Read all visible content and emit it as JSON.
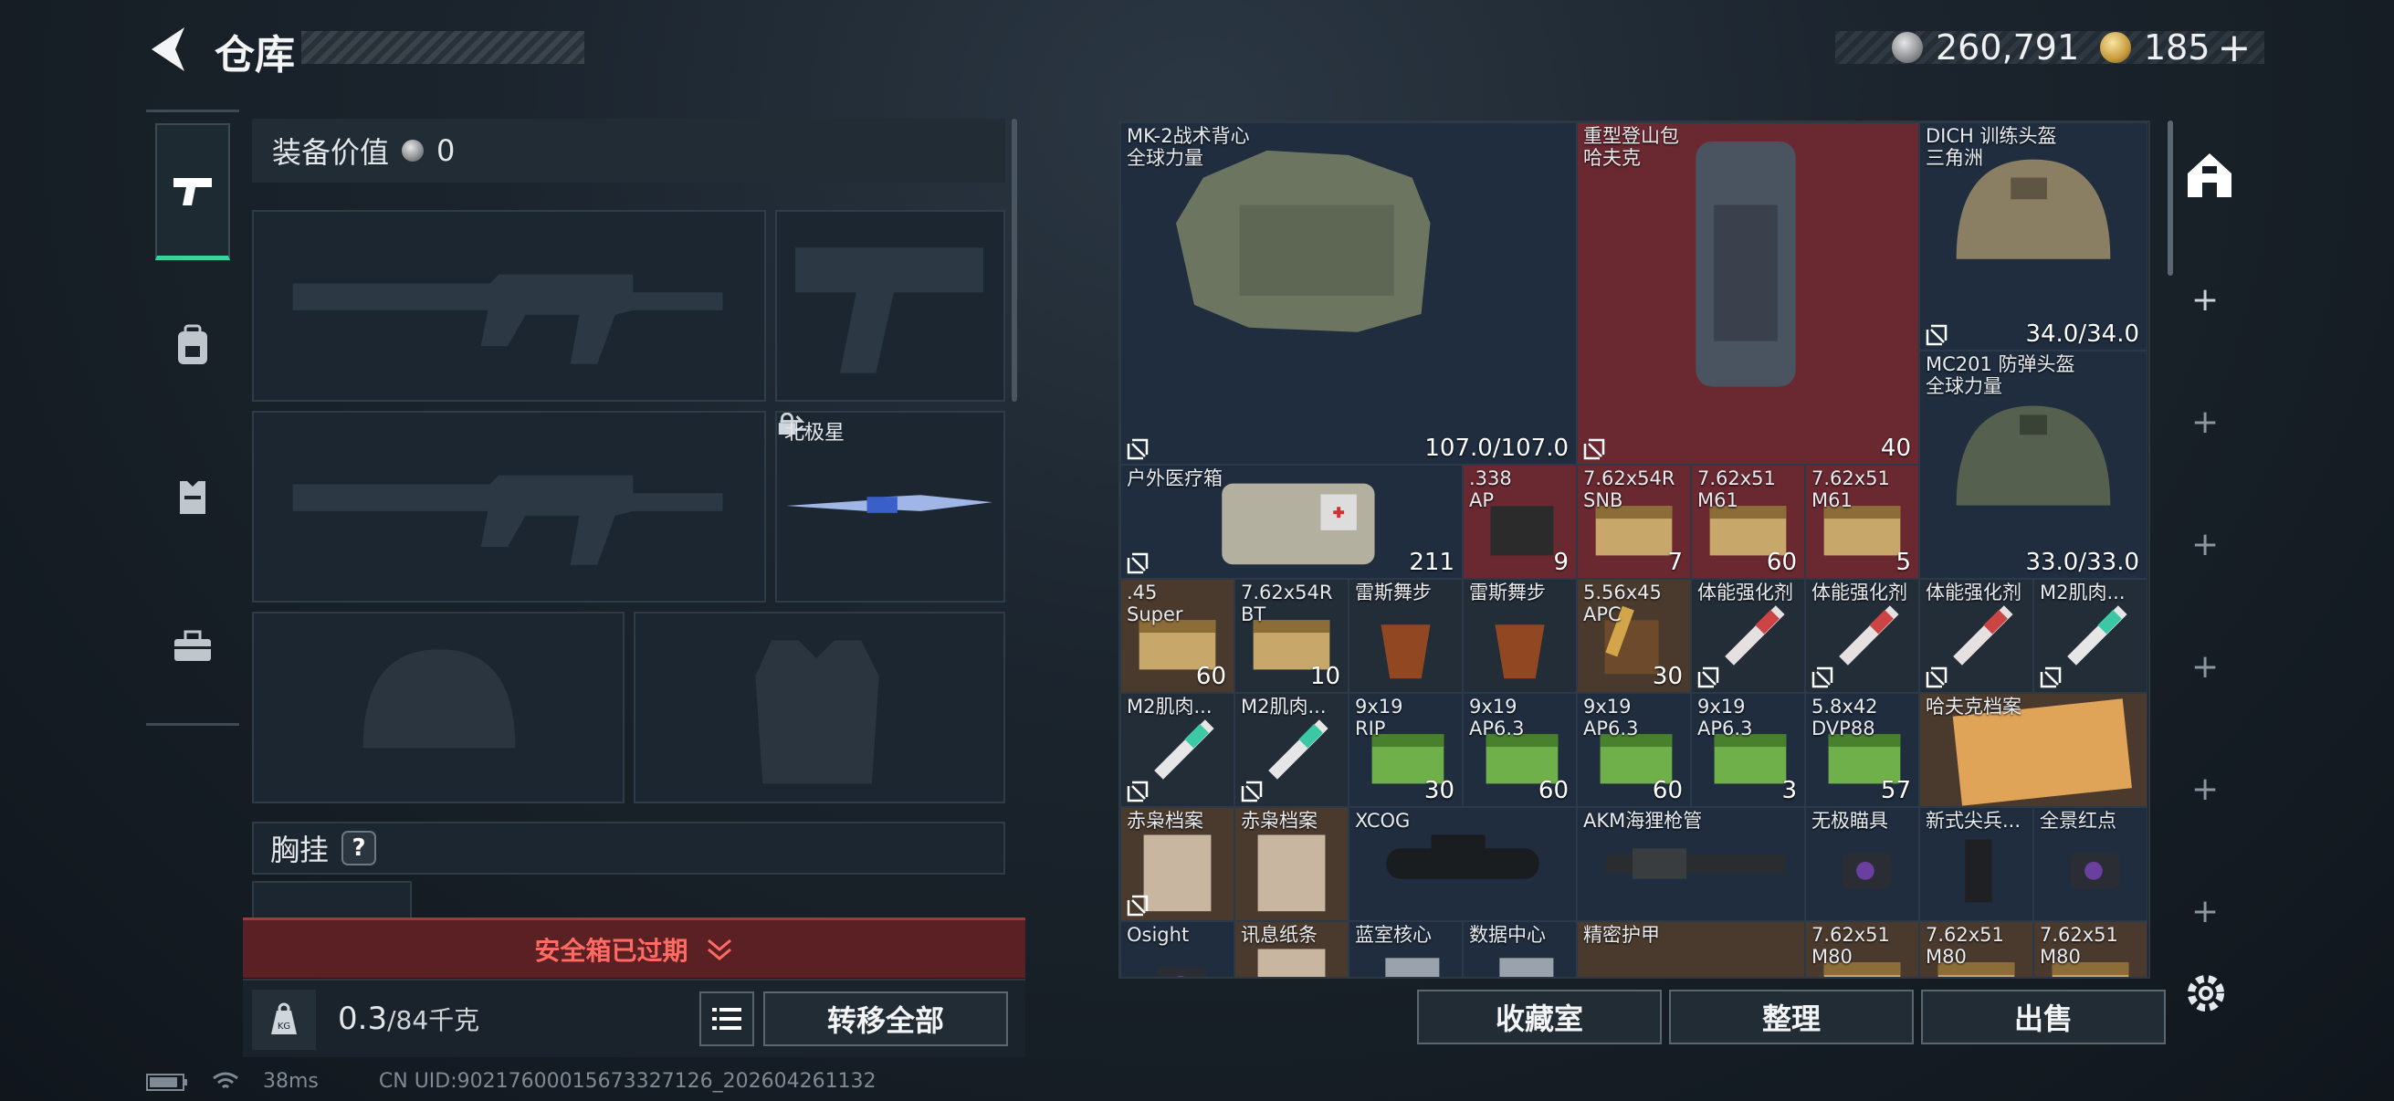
{
  "header": {
    "title": "仓库",
    "silver": "260,791",
    "gold": "185",
    "gold_plus": "+"
  },
  "loadout": {
    "value_label": "装备价值",
    "value": "0",
    "melee_name": "北极星",
    "chest_label": "胸挂",
    "chest_help": "?"
  },
  "safe_box": {
    "label": "安全箱已过期"
  },
  "bottom_left": {
    "weight_value": "0.3",
    "weight_unit": "/84千克",
    "transfer_all": "转移全部"
  },
  "inventory": [
    {
      "name": "MK-2战术背心\n全球力量",
      "count": "107.0/107.0",
      "locked": true
    },
    {
      "name": "重型登山包\n哈夫克",
      "count": "40",
      "locked": true
    },
    {
      "name": "DICH 训练头盔\n三角洲",
      "count": "34.0/34.0",
      "locked": true
    },
    {
      "name": "MC201 防弹头盔\n全球力量",
      "count": "33.0/33.0",
      "locked": false
    },
    {
      "name": "户外医疗箱",
      "count": "211",
      "locked": true
    },
    {
      "name": ".338\nAP",
      "count": "9",
      "locked": false
    },
    {
      "name": "7.62x54R\nSNB",
      "count": "7",
      "locked": false
    },
    {
      "name": "7.62x51\nM61",
      "count": "60",
      "locked": false
    },
    {
      "name": "7.62x51\nM61",
      "count": "5",
      "locked": false
    },
    {
      "name": ".45\nSuper",
      "count": "60",
      "locked": false
    },
    {
      "name": "7.62x54R\nBT",
      "count": "10",
      "locked": false
    },
    {
      "name": "雷斯舞步",
      "count": "",
      "locked": false
    },
    {
      "name": "雷斯舞步",
      "count": "",
      "locked": false
    },
    {
      "name": "5.56x45\nAPC",
      "count": "30",
      "locked": false
    },
    {
      "name": "体能强化剂",
      "count": "",
      "locked": true
    },
    {
      "name": "体能强化剂",
      "count": "",
      "locked": true
    },
    {
      "name": "体能强化剂",
      "count": "",
      "locked": true
    },
    {
      "name": "M2肌肉...",
      "count": "",
      "locked": true
    },
    {
      "name": "M2肌肉...",
      "count": "",
      "locked": true
    },
    {
      "name": "M2肌肉...",
      "count": "",
      "locked": true
    },
    {
      "name": "9x19\nRIP",
      "count": "30",
      "locked": false
    },
    {
      "name": "9x19\nAP6.3",
      "count": "60",
      "locked": false
    },
    {
      "name": "9x19\nAP6.3",
      "count": "60",
      "locked": false
    },
    {
      "name": "9x19\nAP6.3",
      "count": "3",
      "locked": false
    },
    {
      "name": "5.8x42\nDVP88",
      "count": "57",
      "locked": false
    },
    {
      "name": "哈夫克档案",
      "count": "",
      "locked": false
    },
    {
      "name": "赤枭档案",
      "count": "",
      "locked": true
    },
    {
      "name": "赤枭档案",
      "count": "",
      "locked": false
    },
    {
      "name": "XCOG",
      "count": "",
      "locked": false
    },
    {
      "name": "AKM海狸枪管",
      "count": "",
      "locked": false
    },
    {
      "name": "无极瞄具",
      "count": "",
      "locked": false
    },
    {
      "name": "新式尖兵...",
      "count": "",
      "locked": false
    },
    {
      "name": "全景红点",
      "count": "",
      "locked": false
    },
    {
      "name": "Osight",
      "count": "",
      "locked": false
    },
    {
      "name": "讯息纸条",
      "count": "",
      "locked": false
    },
    {
      "name": "蓝室核心",
      "count": "",
      "locked": false
    },
    {
      "name": "数据中心",
      "count": "",
      "locked": false
    },
    {
      "name": "精密护甲",
      "count": "",
      "locked": false
    },
    {
      "name": "7.62x51\nM80",
      "count": "",
      "locked": false
    },
    {
      "name": "7.62x51\nM80",
      "count": "",
      "locked": false
    },
    {
      "name": "7.62x51\nM80",
      "count": "",
      "locked": false
    }
  ],
  "actions": {
    "collection": "收藏室",
    "sort": "整理",
    "sell": "出售"
  },
  "status": {
    "ping": "38ms",
    "uid": "CN UID:90217600015673327126_202604261132"
  },
  "colors": {
    "accent": "#38d39a",
    "warning": "#ff6a63",
    "red_cell": "#6a2830",
    "blue_cell": "#1f2d3f"
  }
}
